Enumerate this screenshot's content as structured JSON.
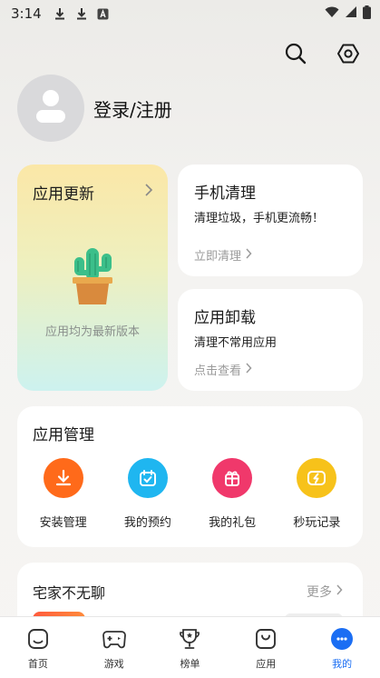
{
  "status_bar": {
    "time": "3:14",
    "left_icons": [
      "download-icon",
      "download-icon",
      "text-app-icon"
    ],
    "right_icons": [
      "wifi-icon",
      "signal-icon",
      "battery-icon"
    ]
  },
  "header": {
    "actions": [
      "search-icon",
      "settings-icon"
    ]
  },
  "profile": {
    "login_label": "登录/注册"
  },
  "update_card": {
    "title": "应用更新",
    "status": "应用均为最新版本"
  },
  "clean_card": {
    "title": "手机清理",
    "desc": "清理垃圾，手机更流畅！",
    "action": "立即清理"
  },
  "uninstall_card": {
    "title": "应用卸载",
    "desc": "清理不常用应用",
    "action": "点击查看"
  },
  "manage": {
    "title": "应用管理",
    "items": [
      {
        "label": "安装管理",
        "icon": "install-icon",
        "color": "#ff6a1a"
      },
      {
        "label": "我的预约",
        "icon": "calendar-check-icon",
        "color": "#1fb6f0"
      },
      {
        "label": "我的礼包",
        "icon": "gift-icon",
        "color": "#f0386b"
      },
      {
        "label": "秒玩记录",
        "icon": "quick-play-icon",
        "color": "#f7c21a"
      }
    ]
  },
  "home_section": {
    "title": "宅家不无聊",
    "more": "更多"
  },
  "bottom_nav": {
    "items": [
      {
        "label": "首页",
        "icon": "home-icon"
      },
      {
        "label": "游戏",
        "icon": "game-icon"
      },
      {
        "label": "榜单",
        "icon": "trophy-icon"
      },
      {
        "label": "应用",
        "icon": "apps-icon"
      },
      {
        "label": "我的",
        "icon": "me-icon",
        "active": true
      }
    ],
    "active_color": "#1b6ef3"
  }
}
